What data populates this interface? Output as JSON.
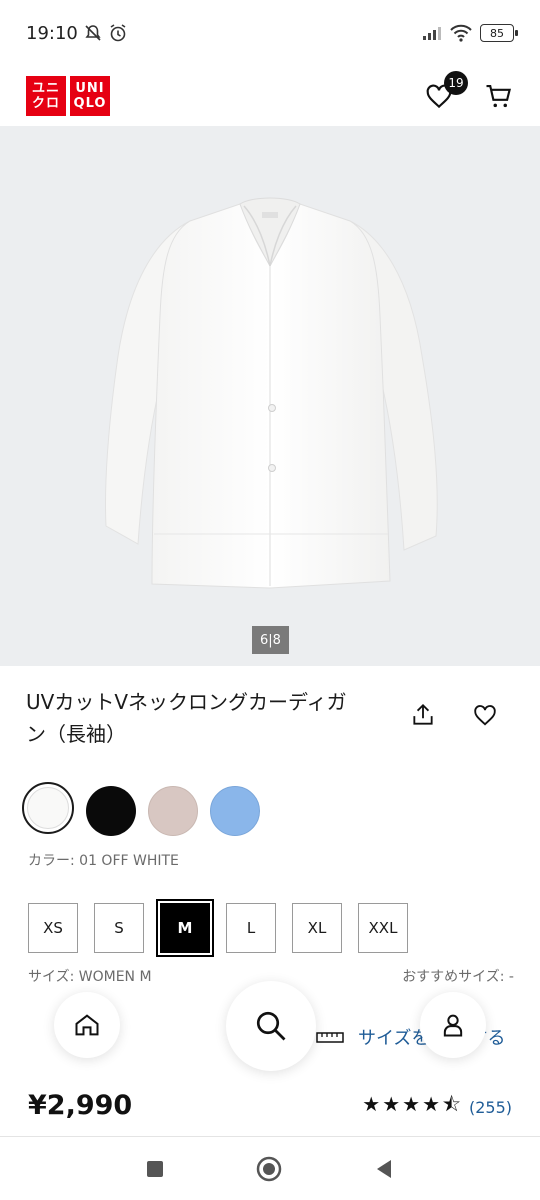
{
  "status": {
    "time": "19:10",
    "battery": "85"
  },
  "brand": {
    "logo_left": "ユニクロ",
    "logo_right": "UNIQLO",
    "red": "#e60012"
  },
  "header": {
    "wishlist_count": "19"
  },
  "gallery": {
    "counter": "6|8"
  },
  "product": {
    "title_line1": "UVカットVネックロングカーディガ",
    "title_line2": "ン（長袖）",
    "color_label": "カラー: 01 OFF WHITE",
    "size_label": "サイズ: WOMEN M",
    "recommended_size": "おすすめサイズ: -",
    "size_guide": "サイズを確認する",
    "size_guide_visible": "サイズを",
    "size_guide_tail": "する",
    "price": "¥2,990",
    "rating_stars": "★★★★⯪",
    "rating_count": "(255)"
  },
  "colors": [
    {
      "name": "off-white",
      "hex": "#f9f9f8",
      "selected": true
    },
    {
      "name": "black",
      "hex": "#0a0a0a",
      "selected": false
    },
    {
      "name": "beige",
      "hex": "#d8c7c2",
      "selected": false
    },
    {
      "name": "blue",
      "hex": "#8ab6ea",
      "selected": false
    }
  ],
  "sizes": [
    "XS",
    "S",
    "M",
    "L",
    "XL",
    "XXL"
  ],
  "selected_size": "M"
}
